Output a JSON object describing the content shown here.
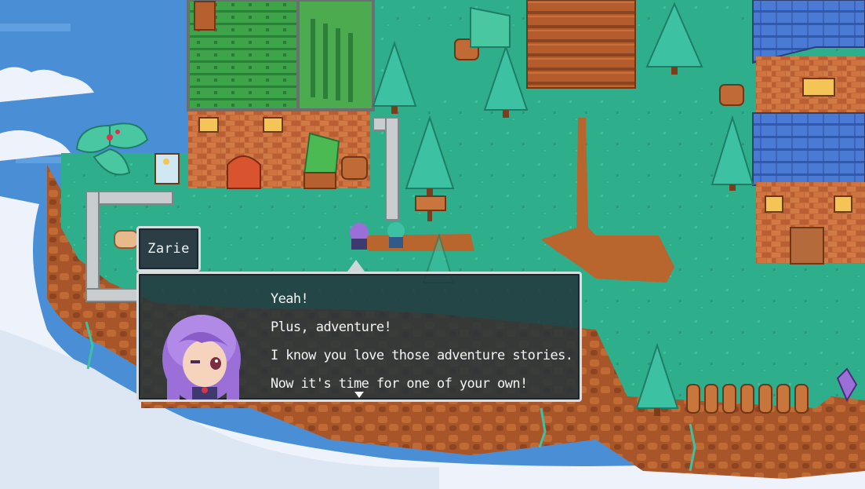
{
  "dialogue": {
    "speaker": "Zarie",
    "lines": [
      "Yeah!",
      "Plus, adventure!",
      "I know you love those adventure stories.",
      "Now it's time for one of your own!"
    ]
  },
  "colors": {
    "sky": "#4a8fd6",
    "cloud": "#eef3fb",
    "grass": "#2fae8c",
    "grass_dark": "#1f8b73",
    "dirt": "#b9652e",
    "cliff": "#a8552a",
    "brick": "#c56a3a",
    "roof_green": "#3fa34a",
    "roof_blue": "#4a7ad4",
    "dialog_bg": "#24343a",
    "dialog_border": "#d8dde0",
    "hair_purple": "#9b6fd8"
  },
  "icons": {
    "advance": "triangle-down-icon",
    "speaker_pointer": "triangle-up-icon"
  }
}
